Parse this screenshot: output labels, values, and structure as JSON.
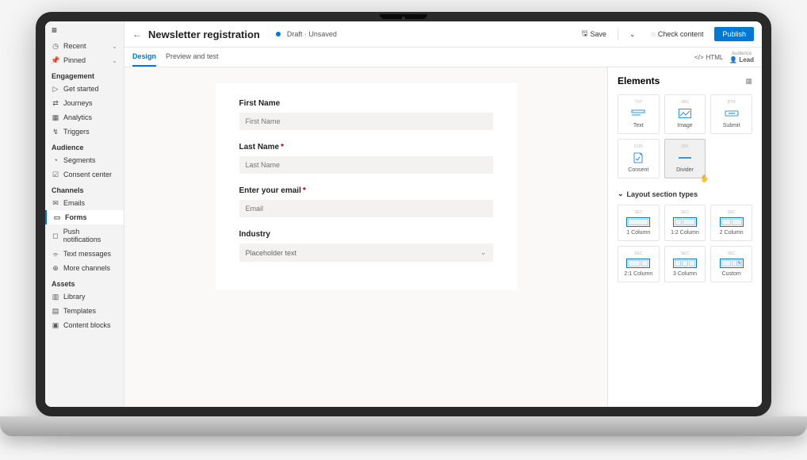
{
  "sidebar": {
    "recent": "Recent",
    "pinned": "Pinned",
    "sections": {
      "engagement": {
        "title": "Engagement",
        "items": [
          "Get started",
          "Journeys",
          "Analytics",
          "Triggers"
        ]
      },
      "audience": {
        "title": "Audience",
        "items": [
          "Segments",
          "Consent center"
        ]
      },
      "channels": {
        "title": "Channels",
        "items": [
          "Emails",
          "Forms",
          "Push notifications",
          "Text messages",
          "More channels"
        ],
        "active": "Forms"
      },
      "assets": {
        "title": "Assets",
        "items": [
          "Library",
          "Templates",
          "Content blocks"
        ]
      }
    }
  },
  "header": {
    "title": "Newsletter registration",
    "status": "Draft",
    "unsaved": "Unsaved",
    "save": "Save",
    "check": "Check content",
    "publish": "Publish"
  },
  "tabs": {
    "design": "Design",
    "preview": "Preview and test",
    "html": "HTML",
    "audience_label": "Audience",
    "audience_value": "Lead"
  },
  "form": {
    "first_name": {
      "label": "First Name",
      "placeholder": "First Name"
    },
    "last_name": {
      "label": "Last Name",
      "placeholder": "Last Name",
      "required": true
    },
    "email": {
      "label": "Enter your email",
      "placeholder": "Email",
      "required": true
    },
    "industry": {
      "label": "Industry",
      "placeholder": "Placeholder text"
    }
  },
  "elements": {
    "title": "Elements",
    "tiles": [
      {
        "id": "text",
        "label": "Text"
      },
      {
        "id": "image",
        "label": "Image"
      },
      {
        "id": "submit",
        "label": "Submit"
      },
      {
        "id": "consent",
        "label": "Consent"
      },
      {
        "id": "divider",
        "label": "Divider"
      }
    ],
    "layouts_title": "Layout section types",
    "layouts": [
      "1 Column",
      "1:2 Column",
      "2 Column",
      "2:1 Column",
      "3 Column",
      "Custom"
    ]
  }
}
